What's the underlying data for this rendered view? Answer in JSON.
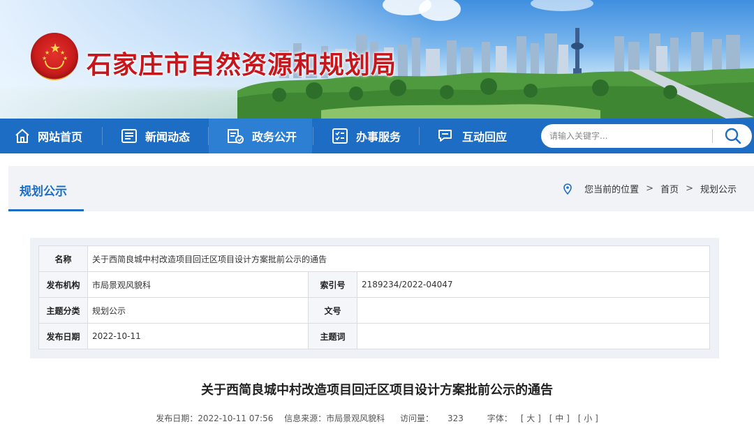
{
  "header": {
    "site_title": "石家庄市自然资源和规划局"
  },
  "nav": {
    "items": [
      {
        "label": "网站首页",
        "icon": "home-icon"
      },
      {
        "label": "新闻动态",
        "icon": "news-icon"
      },
      {
        "label": "政务公开",
        "icon": "open-government-icon"
      },
      {
        "label": "办事服务",
        "icon": "service-icon"
      },
      {
        "label": "互动回应",
        "icon": "chat-icon"
      }
    ],
    "active_index": 2
  },
  "search": {
    "placeholder": "请输入关键字..."
  },
  "section": {
    "title": "规划公示",
    "breadcrumb": {
      "prefix": "您当前的位置",
      "items": [
        "首页",
        "规划公示"
      ],
      "separator": ">"
    }
  },
  "info": {
    "name_label": "名称",
    "name_value": "关于西简良城中村改造项目回迁区项目设计方案批前公示的通告",
    "publisher_label": "发布机构",
    "publisher_value": "市局景观风貌科",
    "index_label": "索引号",
    "index_value": "2189234/2022-04047",
    "category_label": "主题分类",
    "category_value": "规划公示",
    "doc_no_label": "文号",
    "doc_no_value": "",
    "date_label": "发布日期",
    "date_value": "2022-10-11",
    "keyword_label": "主题词",
    "keyword_value": ""
  },
  "article": {
    "title": "关于西简良城中村改造项目回迁区项目设计方案批前公示的通告",
    "meta": {
      "date": "发布日期：2022-10-11 07:56",
      "source": "信息来源：市局景观风貌科",
      "views_label": "访问量：",
      "views": "323",
      "font_label": "字体：",
      "font_large": "[ 大 ]",
      "font_medium": "[ 中 ]",
      "font_small": "[ 小 ]"
    }
  },
  "colors": {
    "brand_blue": "#1d6dc4",
    "title_red": "#c8161d"
  }
}
